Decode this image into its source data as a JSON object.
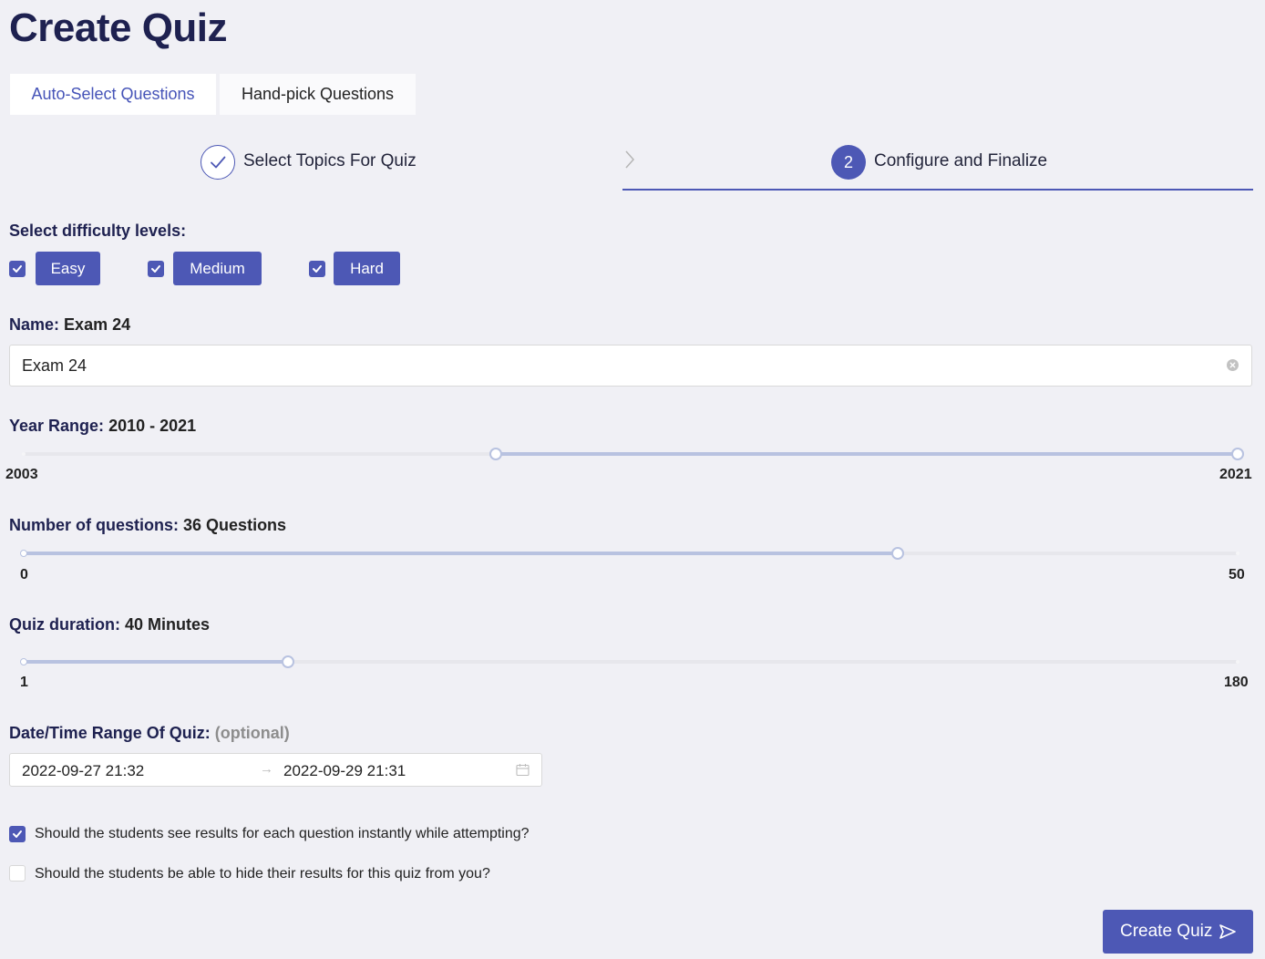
{
  "page": {
    "title": "Create Quiz"
  },
  "tabs": [
    {
      "label": "Auto-Select Questions",
      "active": true
    },
    {
      "label": "Hand-pick Questions",
      "active": false
    }
  ],
  "steps": [
    {
      "label": "Select Topics For Quiz",
      "status": "done",
      "icon": "check-icon"
    },
    {
      "number": "2",
      "label": "Configure and Finalize",
      "status": "current"
    }
  ],
  "difficulty": {
    "label": "Select difficulty levels:",
    "levels": [
      {
        "label": "Easy",
        "checked": true
      },
      {
        "label": "Medium",
        "checked": true
      },
      {
        "label": "Hard",
        "checked": true
      }
    ]
  },
  "name": {
    "label": "Name:",
    "display_value": "Exam 24",
    "input_value": "Exam 24"
  },
  "year_range": {
    "label": "Year Range:",
    "display_value": "2010 - 2021",
    "min_label": "2003",
    "max_label": "2021",
    "min": 2003,
    "max": 2021,
    "value": [
      2010,
      2021
    ]
  },
  "num_questions": {
    "label": "Number of questions:",
    "display_value": "36 Questions",
    "min_label": "0",
    "max_label": "50",
    "min": 0,
    "max": 50,
    "value": 36
  },
  "duration": {
    "label": "Quiz duration:",
    "display_value": "40 Minutes",
    "min_label": "1",
    "max_label": "180",
    "min": 1,
    "max": 180,
    "value": 40
  },
  "date_range": {
    "label": "Date/Time Range Of Quiz:",
    "optional": "(optional)",
    "start": "2022-09-27 21:32",
    "arrow": "→",
    "end": "2022-09-29 21:31"
  },
  "options": [
    {
      "label": "Should the students see results for each question instantly while attempting?",
      "checked": true
    },
    {
      "label": "Should the students be able to hide their results for this quiz from you?",
      "checked": false
    }
  ],
  "submit": {
    "label": "Create Quiz",
    "icon": "send-icon"
  },
  "colors": {
    "accent": "#4d58b5",
    "background": "#f0f0f5",
    "slider_track": "#b8c2e0"
  }
}
